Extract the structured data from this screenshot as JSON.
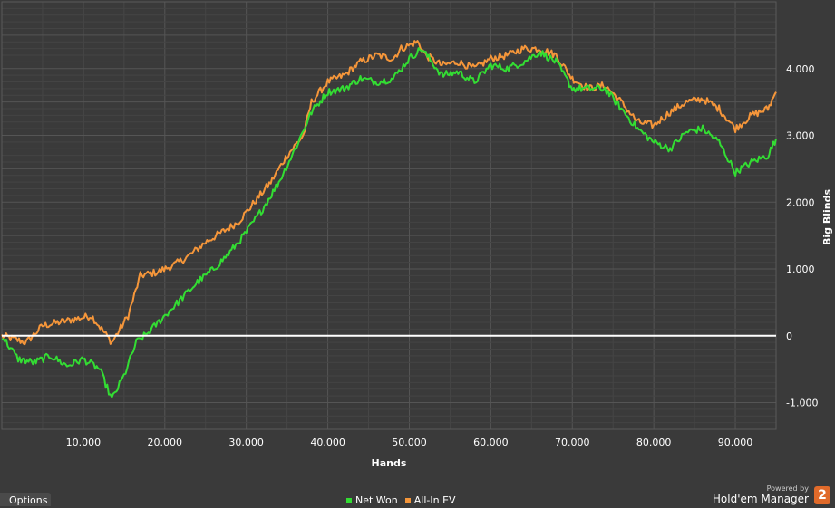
{
  "chart_data": {
    "type": "line",
    "xlabel": "Hands",
    "ylabel": "Big Blinds",
    "xlim": [
      0,
      95000
    ],
    "ylim": [
      -1400,
      5000
    ],
    "x_ticks": [
      10000,
      20000,
      30000,
      40000,
      50000,
      60000,
      70000,
      80000,
      90000
    ],
    "x_tick_labels": [
      "10.000",
      "20.000",
      "30.000",
      "40.000",
      "50.000",
      "60.000",
      "70.000",
      "80.000",
      "90.000"
    ],
    "y_ticks": [
      -1000,
      0,
      1000,
      2000,
      3000,
      4000
    ],
    "y_tick_labels": [
      "-1.000",
      "0",
      "1.000",
      "2.000",
      "3.000",
      "4.000"
    ],
    "grid": true,
    "legend_position": "bottom-center",
    "series": [
      {
        "name": "All-In EV",
        "color": "#f5963a",
        "x": [
          0,
          3000,
          5000,
          7000,
          9000,
          11000,
          13500,
          15500,
          17000,
          19000,
          21000,
          23000,
          25000,
          27000,
          29000,
          31000,
          33000,
          35000,
          37000,
          38000,
          40000,
          42000,
          44000,
          46000,
          48000,
          49000,
          51000,
          52000,
          54000,
          56000,
          58000,
          60000,
          62000,
          64000,
          66000,
          68000,
          70000,
          72000,
          74000,
          76000,
          78000,
          80000,
          82000,
          84000,
          86000,
          88000,
          90000,
          92000,
          94000,
          95000
        ],
        "y": [
          0,
          -100,
          150,
          200,
          250,
          300,
          -100,
          300,
          900,
          950,
          1050,
          1200,
          1400,
          1550,
          1700,
          2000,
          2300,
          2700,
          3000,
          3500,
          3800,
          3900,
          4100,
          4200,
          4150,
          4300,
          4400,
          4200,
          4050,
          4100,
          4000,
          4150,
          4200,
          4300,
          4300,
          4200,
          3850,
          3700,
          3750,
          3500,
          3200,
          3150,
          3350,
          3500,
          3550,
          3400,
          3100,
          3300,
          3400,
          3650
        ]
      },
      {
        "name": "Net Won",
        "color": "#33dd33",
        "x": [
          0,
          2000,
          4000,
          6000,
          8000,
          10000,
          12000,
          13500,
          15000,
          16500,
          18000,
          20000,
          22000,
          24000,
          26000,
          28000,
          30000,
          32000,
          34000,
          36000,
          38000,
          40000,
          42000,
          44000,
          46000,
          48000,
          50000,
          51500,
          54000,
          56000,
          58000,
          60000,
          62000,
          64000,
          66000,
          68000,
          70000,
          72000,
          74000,
          76000,
          78000,
          80000,
          82000,
          84000,
          86000,
          88000,
          90000,
          92000,
          94000,
          95000
        ],
        "y": [
          0,
          -350,
          -400,
          -300,
          -450,
          -350,
          -500,
          -950,
          -600,
          -100,
          50,
          300,
          550,
          800,
          1000,
          1250,
          1550,
          1900,
          2300,
          2800,
          3350,
          3650,
          3700,
          3850,
          3800,
          3850,
          4150,
          4300,
          3900,
          3950,
          3800,
          4050,
          4000,
          4100,
          4250,
          4100,
          3700,
          3700,
          3700,
          3400,
          3100,
          2900,
          2800,
          3050,
          3100,
          2900,
          2450,
          2600,
          2700,
          2950
        ]
      }
    ]
  },
  "ui": {
    "options_label": "Options",
    "legend": [
      "Net Won",
      "All-In EV"
    ],
    "powered_by": "Powered by",
    "brand_name": "Hold'em Manager",
    "brand_logo": "2"
  }
}
